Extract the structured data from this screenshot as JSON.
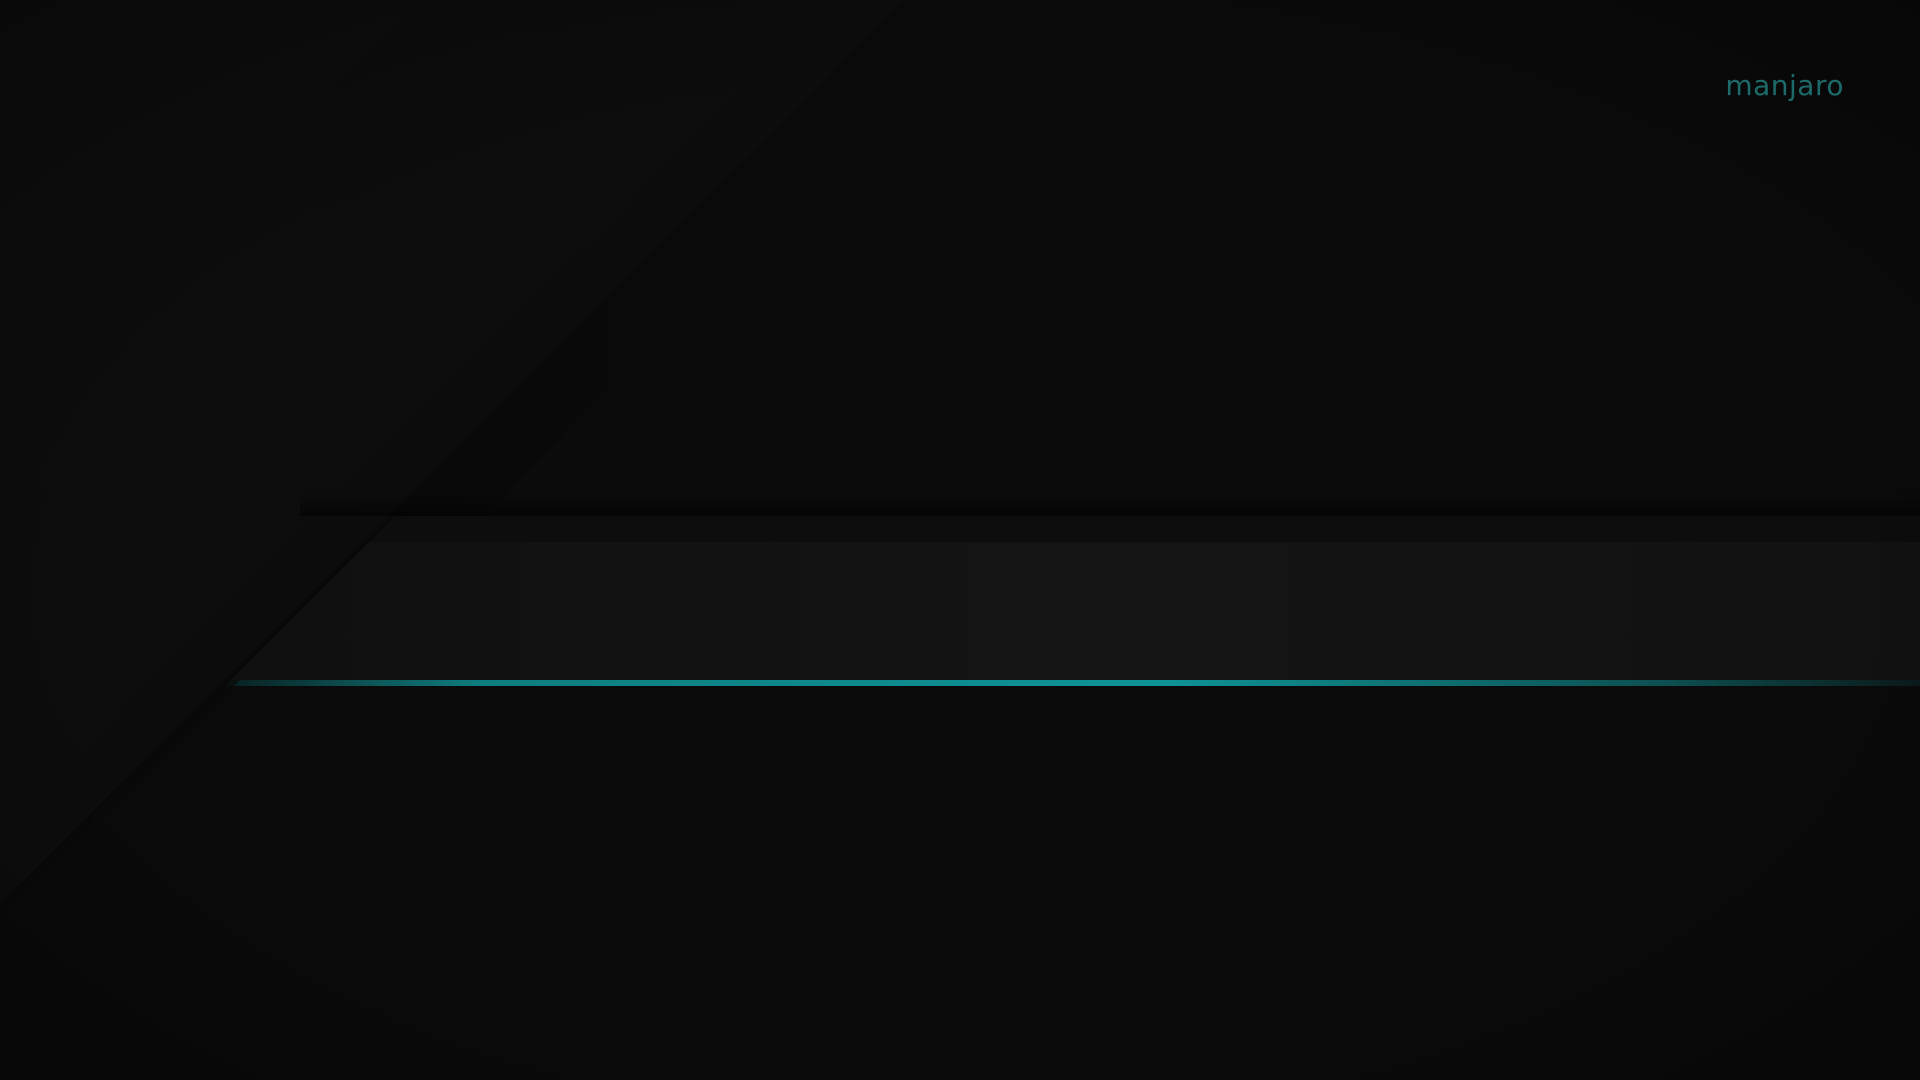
{
  "wallpaper": {
    "brand_text": "manjaro",
    "accent_color": "#0fa3a6",
    "background_color": "#0a0a0a",
    "band_color": "#121212",
    "shadow_color": "#050505"
  }
}
